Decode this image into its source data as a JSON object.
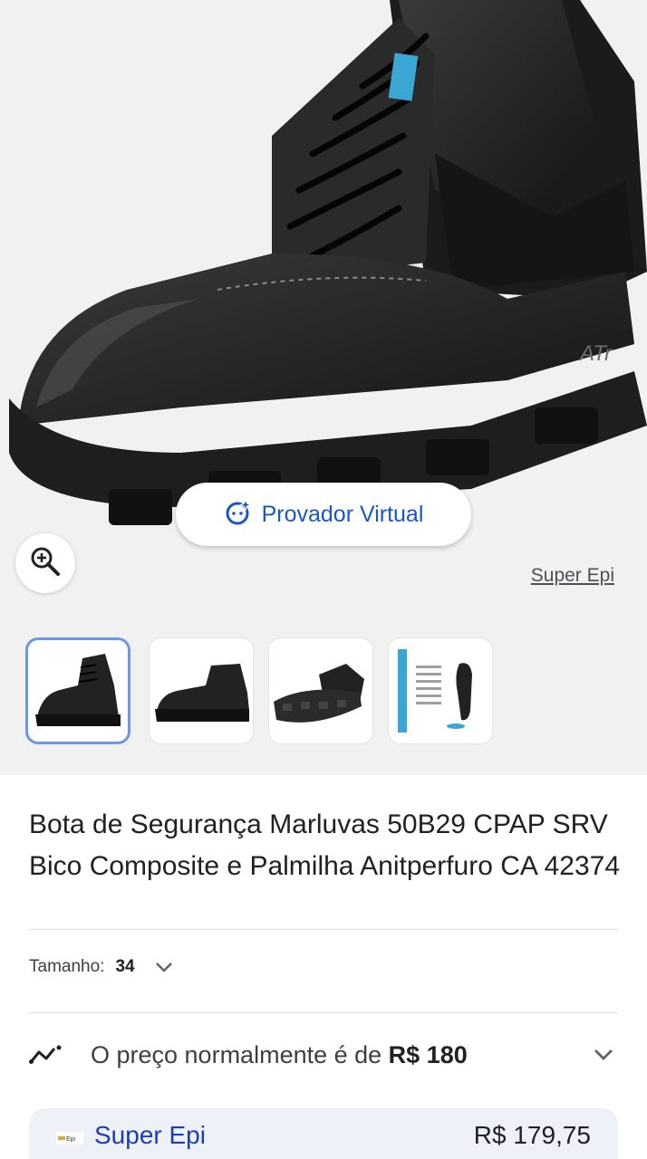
{
  "product": {
    "title": "Bota de Segurança Marluvas 50B29 CPAP SRV Bico Composite e Palmilha Anitperfuro CA 42374",
    "image_source": "Super Epi"
  },
  "try_on": {
    "label": "Provador Virtual"
  },
  "thumbnails": [
    {
      "name": "boot-front-view",
      "selected": true
    },
    {
      "name": "boot-side-view",
      "selected": false
    },
    {
      "name": "boot-sole-view",
      "selected": false
    },
    {
      "name": "size-chart",
      "selected": false
    }
  ],
  "size": {
    "label": "Tamanho:",
    "value": "34"
  },
  "price_insight": {
    "prefix": "O preço normalmente é de ",
    "amount": "R$ 180"
  },
  "offer": {
    "store": "Super Epi",
    "logo_text": "superEpi",
    "price": "R$ 179,75"
  },
  "colors": {
    "accent": "#1a56c4",
    "store_link": "#1a3db8",
    "thumb_border": "#6e97e3",
    "offer_bg": "#eef1f7"
  },
  "icons": {
    "try_on": "sparkle-face-icon",
    "zoom": "zoom-in-icon",
    "trend": "trend-line-icon",
    "chevron": "chevron-down-icon"
  }
}
